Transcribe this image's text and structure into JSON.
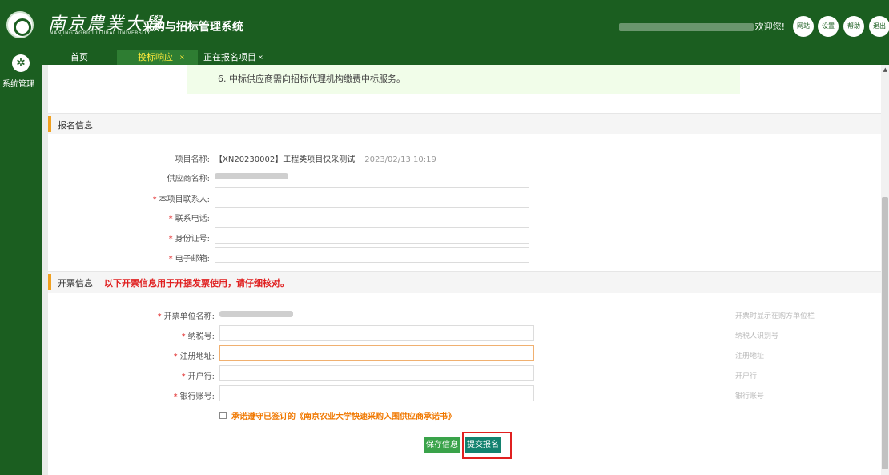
{
  "header": {
    "university_name": "南京農業大學",
    "university_en": "NANJING AGRICULTURAL UNIVERSITY",
    "system_name": "采购与招标管理系统",
    "welcome_text": "欢迎您!",
    "buttons": [
      "网站",
      "设置",
      "帮助",
      "退出"
    ]
  },
  "sidebar": {
    "items": [
      {
        "label": "系统管理",
        "icon": "gear-icon"
      }
    ]
  },
  "tabs": [
    {
      "label": "首页",
      "active": false
    },
    {
      "label": "投标响应",
      "active": true,
      "close": "×"
    },
    {
      "label": "正在报名项目",
      "active": false,
      "close": "×"
    }
  ],
  "notice": {
    "line": "6. 中标供应商需向招标代理机构缴费中标服务。"
  },
  "signup_section": {
    "title": "报名信息",
    "project_name_label": "项目名称:",
    "project_name": "【XN20230002】工程类项目快采测试",
    "project_date": "2023/02/13 10:19",
    "supplier_label": "供应商名称:",
    "fields": [
      {
        "label": "本项目联系人:",
        "value": ""
      },
      {
        "label": "联系电话:",
        "value": ""
      },
      {
        "label": "身份证号:",
        "value": ""
      },
      {
        "label": "电子邮箱:",
        "value": ""
      }
    ]
  },
  "invoice_section": {
    "title": "开票信息",
    "warning": "以下开票信息用于开据发票使用，请仔细核对。",
    "company_label": "开票单位名称:",
    "company_hint": "开票时显示在购方单位栏",
    "fields": [
      {
        "label": "纳税号:",
        "value": "",
        "hint": "纳税人识别号"
      },
      {
        "label": "注册地址:",
        "value": "",
        "hint": "注册地址"
      },
      {
        "label": "开户行:",
        "value": "",
        "hint": "开户行"
      },
      {
        "label": "银行账号:",
        "value": "",
        "hint": "银行账号"
      }
    ]
  },
  "agreement": {
    "checked": false,
    "text": "承诺遵守已签订的《南京农业大学快速采购入围供应商承诺书》"
  },
  "actions": {
    "save_label": "保存信息",
    "submit_label": "提交报名"
  },
  "colors": {
    "brand_green": "#1b5e20",
    "warning_red": "#e02020",
    "accent_orange": "#f07800",
    "save_green": "#3aa34a",
    "submit_teal": "#13826f"
  }
}
